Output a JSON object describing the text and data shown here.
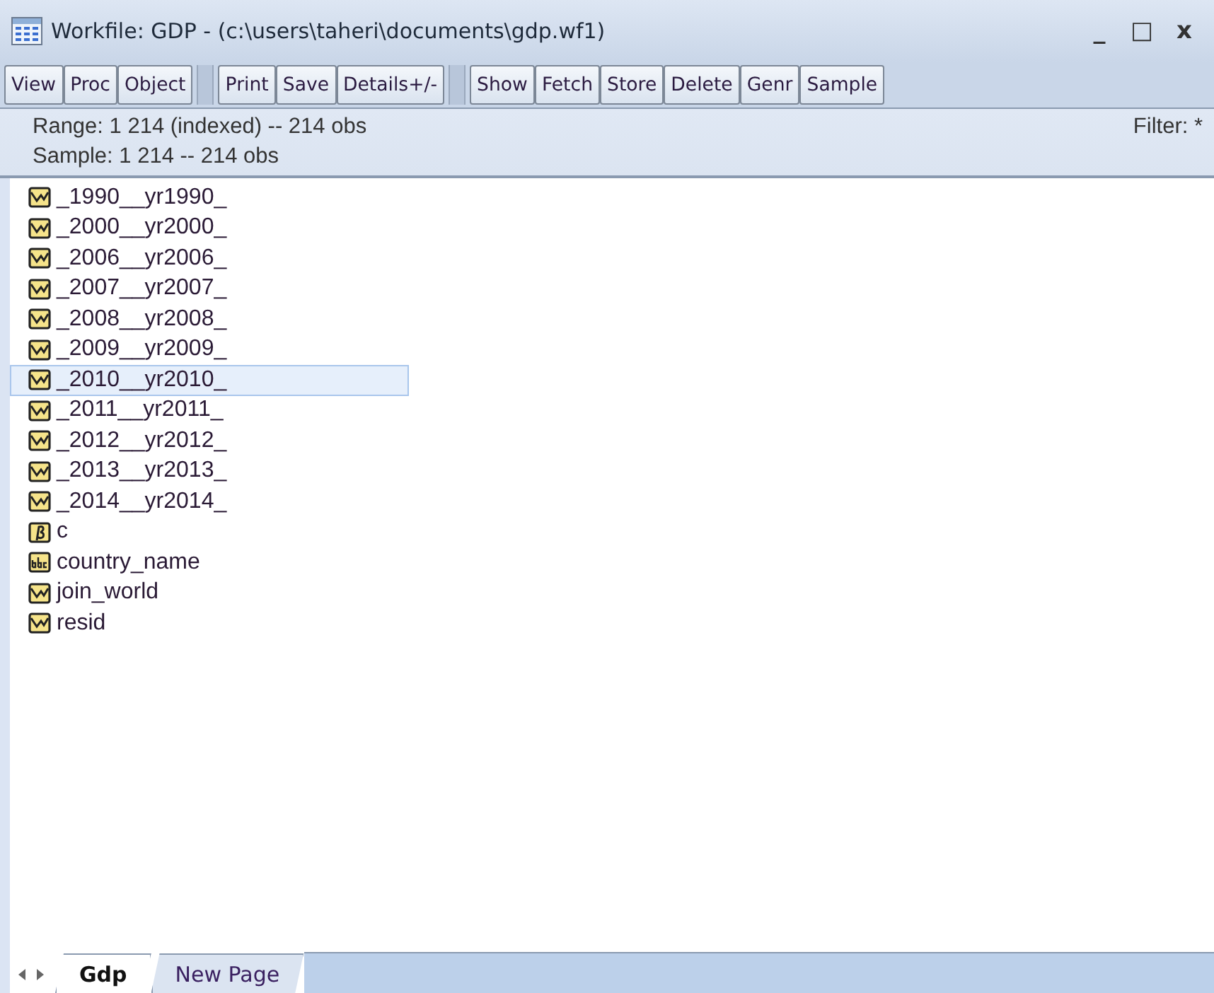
{
  "window": {
    "title": "Workfile: GDP - (c:\\users\\taheri\\documents\\gdp.wf1)",
    "controls": [
      "_",
      "□",
      "x"
    ]
  },
  "toolbar": {
    "groups": [
      [
        "View",
        "Proc",
        "Object"
      ],
      [
        "Print",
        "Save",
        "Details+/-"
      ],
      [
        "Show",
        "Fetch",
        "Store",
        "Delete",
        "Genr",
        "Sample"
      ]
    ]
  },
  "info": {
    "range": "Range:  1 214 (indexed)  --  214 obs",
    "filter": "Filter: *",
    "sample": "Sample: 1 214  --  214 obs"
  },
  "objects": [
    {
      "name": "_1990__yr1990_",
      "kind": "series",
      "selected": false
    },
    {
      "name": "_2000__yr2000_",
      "kind": "series",
      "selected": false
    },
    {
      "name": "_2006__yr2006_",
      "kind": "series",
      "selected": false
    },
    {
      "name": "_2007__yr2007_",
      "kind": "series",
      "selected": false
    },
    {
      "name": "_2008__yr2008_",
      "kind": "series",
      "selected": false
    },
    {
      "name": "_2009__yr2009_",
      "kind": "series",
      "selected": false
    },
    {
      "name": "_2010__yr2010_",
      "kind": "series",
      "selected": true
    },
    {
      "name": "_2011__yr2011_",
      "kind": "series",
      "selected": false
    },
    {
      "name": "_2012__yr2012_",
      "kind": "series",
      "selected": false
    },
    {
      "name": "_2013__yr2013_",
      "kind": "series",
      "selected": false
    },
    {
      "name": "_2014__yr2014_",
      "kind": "series",
      "selected": false
    },
    {
      "name": "c",
      "kind": "coef",
      "selected": false
    },
    {
      "name": "country_name",
      "kind": "alpha",
      "selected": false
    },
    {
      "name": "join_world",
      "kind": "series",
      "selected": false
    },
    {
      "name": "resid",
      "kind": "series",
      "selected": false
    }
  ],
  "page_tabs": [
    {
      "label": "Gdp",
      "selected": true
    },
    {
      "label": "New Page",
      "selected": false
    }
  ]
}
